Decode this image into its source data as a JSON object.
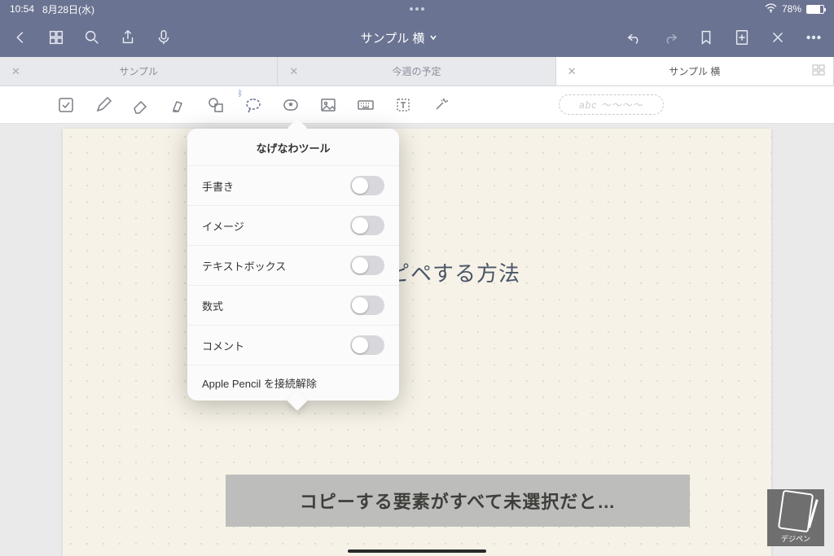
{
  "status": {
    "time": "10:54",
    "date": "8月28日(水)",
    "battery": "78%"
  },
  "nav": {
    "title": "サンプル 横"
  },
  "tabs": [
    {
      "label": "サンプル",
      "active": false
    },
    {
      "label": "今週の予定",
      "active": false
    },
    {
      "label": "サンプル 横",
      "active": true
    }
  ],
  "title_chip": "abc ～～～～",
  "popup": {
    "title": "なげなわツール",
    "rows": [
      {
        "label": "手書き",
        "on": false
      },
      {
        "label": "イメージ",
        "on": false
      },
      {
        "label": "テキストボックス",
        "on": false
      },
      {
        "label": "数式",
        "on": false
      },
      {
        "label": "コメント",
        "on": false
      }
    ],
    "footer": "Apple Pencil を接続解除"
  },
  "handwriting": "ピペする方法",
  "caption": "コピーする要素がすべて未選択だと…",
  "stamp_label": "デジペン"
}
